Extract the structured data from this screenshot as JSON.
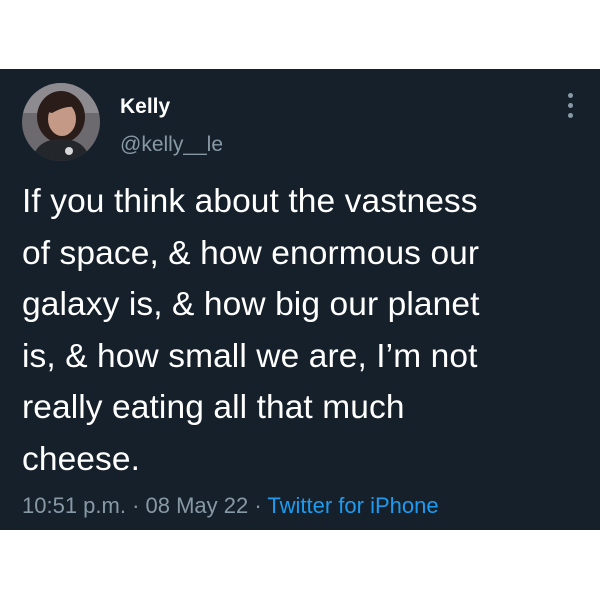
{
  "tweet": {
    "author": {
      "display_name": "Kelly",
      "handle": "@kelly__le",
      "avatar_icon": "profile-photo"
    },
    "text": "If you think about the vastness\nof space, & how enormous our\ngalaxy is, & how big our planet\nis, & how small we are, I’m not\nreally eating all that much\ncheese.",
    "time": "10:51 p.m.",
    "separator": " · ",
    "date": "08 May 22",
    "source": "Twitter for iPhone",
    "more_icon": "more-vertical-icon"
  },
  "colors": {
    "card_background": "#15202b",
    "primary_text": "#ffffff",
    "secondary_text": "#8899a6",
    "link": "#1d9bf0",
    "page_background": "#ffffff"
  }
}
